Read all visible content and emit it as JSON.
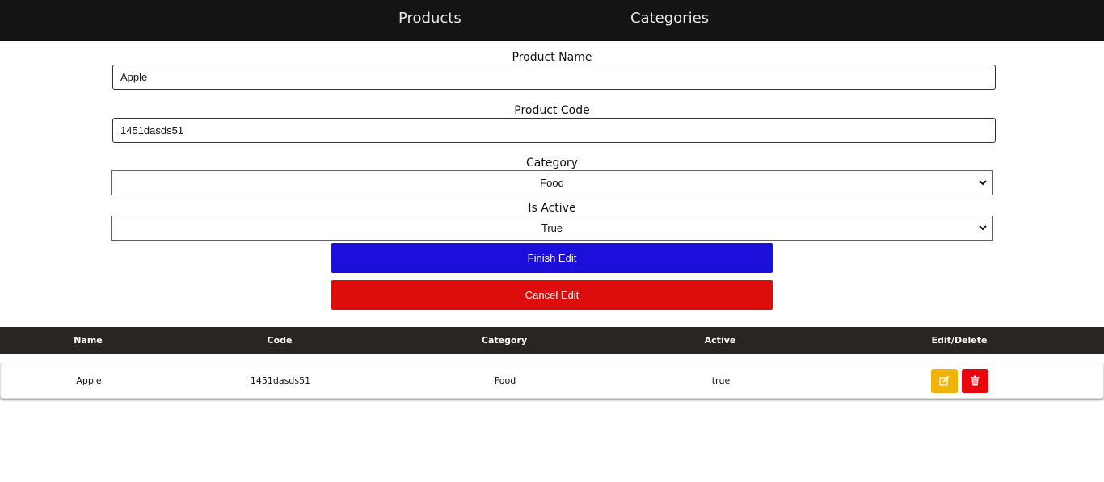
{
  "nav": {
    "products": "Products",
    "categories": "Categories"
  },
  "form": {
    "product_name_label": "Product Name",
    "product_name_value": "Apple",
    "product_code_label": "Product Code",
    "product_code_value": "1451dasds51",
    "category_label": "Category",
    "category_value": "Food",
    "is_active_label": "Is Active",
    "is_active_value": "True",
    "finish_label": "Finish Edit",
    "cancel_label": "Cancel Edit"
  },
  "table": {
    "headers": [
      "Name",
      "Code",
      "Category",
      "Active",
      "Edit/Delete"
    ],
    "rows": [
      {
        "name": "Apple",
        "code": "1451dasds51",
        "category": "Food",
        "active": "true"
      }
    ]
  },
  "icons": {
    "edit": "edit-icon",
    "delete": "trash-icon"
  },
  "colors": {
    "nav_bg": "#141414",
    "finish_button": "#1c0fdc",
    "cancel_button": "#de0d0d",
    "table_header_bg": "#2a2523",
    "edit_button": "#f0b20b",
    "delete_button": "#e8070f"
  }
}
